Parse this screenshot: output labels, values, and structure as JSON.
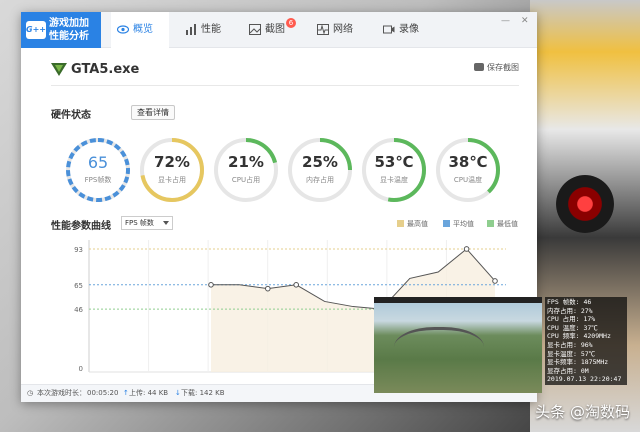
{
  "app": {
    "logo_line1": "游戏加加",
    "logo_line2": "性能分析",
    "logo_badge": "G++"
  },
  "tabs": [
    {
      "label": "概览",
      "icon": "eye-icon",
      "active": true
    },
    {
      "label": "性能",
      "icon": "bar-chart-icon",
      "active": false
    },
    {
      "label": "截图",
      "icon": "image-icon",
      "active": false,
      "badge": "6"
    },
    {
      "label": "网络",
      "icon": "network-icon",
      "active": false
    },
    {
      "label": "录像",
      "icon": "video-icon",
      "active": false
    }
  ],
  "window_controls": {
    "minimize": "—",
    "close": "✕"
  },
  "game": {
    "name": "GTA5.exe",
    "save_screenshot": "保存截图"
  },
  "hardware": {
    "title": "硬件状态",
    "details_button": "查看详情"
  },
  "gauges": [
    {
      "value": "65",
      "label": "FPS帧数",
      "percent": 100,
      "color": "#4a90d9"
    },
    {
      "value": "72%",
      "label": "显卡占用",
      "percent": 72,
      "color": "#e6c760"
    },
    {
      "value": "21%",
      "label": "CPU占用",
      "percent": 21,
      "color": "#5cb85c"
    },
    {
      "value": "25%",
      "label": "内存占用",
      "percent": 25,
      "color": "#5cb85c"
    },
    {
      "value": "53℃",
      "label": "显卡温度",
      "percent": 53,
      "color": "#5cb85c"
    },
    {
      "value": "38℃",
      "label": "CPU温度",
      "percent": 38,
      "color": "#5cb85c"
    }
  ],
  "perf": {
    "title": "性能参数曲线",
    "select_value": "FPS 帧数",
    "legend": [
      {
        "label": "最高值",
        "color": "#e6cf8c"
      },
      {
        "label": "平均值",
        "color": "#6aa5dc"
      },
      {
        "label": "最低值",
        "color": "#8fce8f"
      }
    ]
  },
  "chart_data": {
    "type": "line",
    "yticks": [
      93,
      65,
      46,
      0
    ],
    "ylim": [
      0,
      100
    ],
    "max_line": 93,
    "avg_line": 65,
    "min_line": 46,
    "series": [
      {
        "values": [
          65,
          65,
          62,
          65,
          52,
          48,
          46,
          70,
          75,
          93,
          68
        ]
      }
    ]
  },
  "overlay": {
    "stats": [
      "FPS 帧数: 46",
      "内存占用: 27%",
      "CPU 占用: 17%",
      "CPU 温度: 37℃",
      "CPU 频率: 4209MHz",
      "显卡占用: 96%",
      "显卡温度: 57℃",
      "显卡频率: 1875MHz",
      "显存占用: 0M",
      "2019.07.13 22:20:47"
    ]
  },
  "statusbar": {
    "duration_label": "本次游戏时长：",
    "duration_value": "00:05:20",
    "upload": "上传: 44 KB",
    "download": "下载: 142 KB"
  },
  "watermark": "头条 @淘数码"
}
